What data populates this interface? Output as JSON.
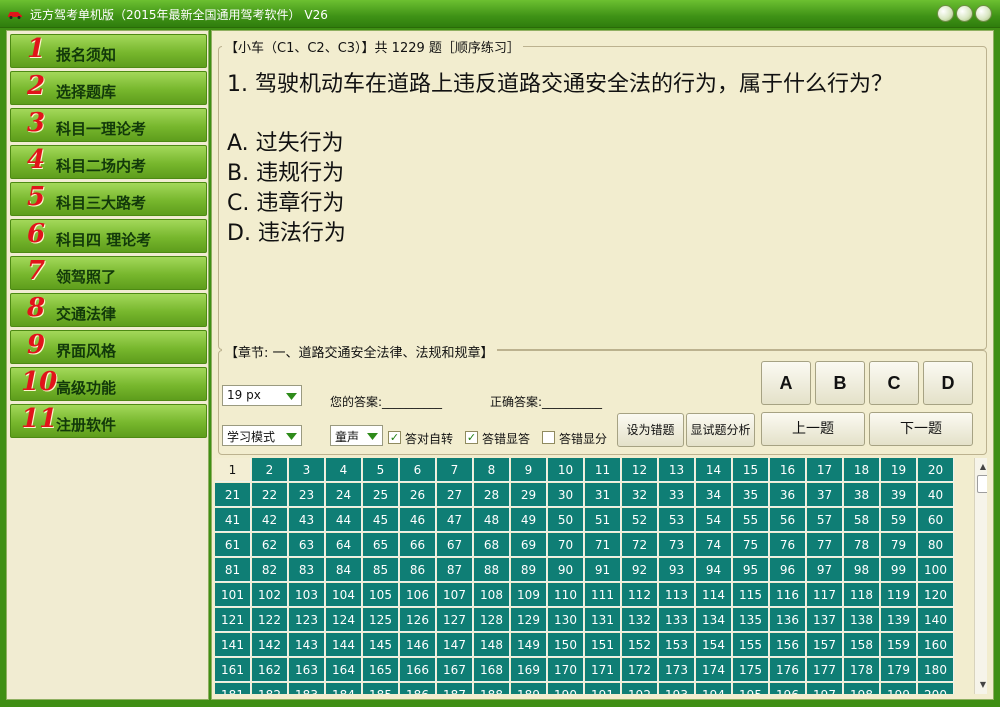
{
  "window": {
    "title": "远方驾考单机版（2015年最新全国通用驾考软件） V26",
    "accent_color": "#3f8f14"
  },
  "sidebar": {
    "items": [
      {
        "num": "1",
        "label": "报名须知"
      },
      {
        "num": "2",
        "label": "选择题库"
      },
      {
        "num": "3",
        "label": "科目一理论考"
      },
      {
        "num": "4",
        "label": "科目二场内考"
      },
      {
        "num": "5",
        "label": "科目三大路考"
      },
      {
        "num": "6",
        "label": "科目四 理论考"
      },
      {
        "num": "7",
        "label": "领驾照了"
      },
      {
        "num": "8",
        "label": "交通法律"
      },
      {
        "num": "9",
        "label": "界面风格"
      },
      {
        "num": "10",
        "label": "高级功能"
      },
      {
        "num": "11",
        "label": "注册软件"
      }
    ]
  },
  "question": {
    "header": "【小车（C1、C2、C3）】共 1229 题［顺序练习］",
    "text": "1. 驾驶机动车在道路上违反道路交通安全法的行为，属于什么行为？",
    "options": [
      "A. 过失行为",
      "B. 违规行为",
      "C. 违章行为",
      "D. 违法行为"
    ]
  },
  "chapter": {
    "header": "【章节: 一、道路交通安全法律、法规和规章】"
  },
  "controls": {
    "font_size": "19 px",
    "mode": "学习模式",
    "voice": "童声",
    "your_answer_label": "您的答案:__________",
    "correct_answer_label": "正确答案:__________",
    "checkboxes": [
      {
        "label": "答对自转",
        "checked": true
      },
      {
        "label": "答错显答",
        "checked": true
      },
      {
        "label": "答错显分",
        "checked": false
      }
    ],
    "set_wrong_label": "设为错题",
    "show_analysis_label": "显试题分析",
    "answer_buttons": [
      "A",
      "B",
      "C",
      "D"
    ],
    "prev_label": "上一题",
    "next_label": "下一题"
  },
  "grid": {
    "total_visible": 200,
    "current": 1,
    "cell_color": "#0f7e75"
  }
}
